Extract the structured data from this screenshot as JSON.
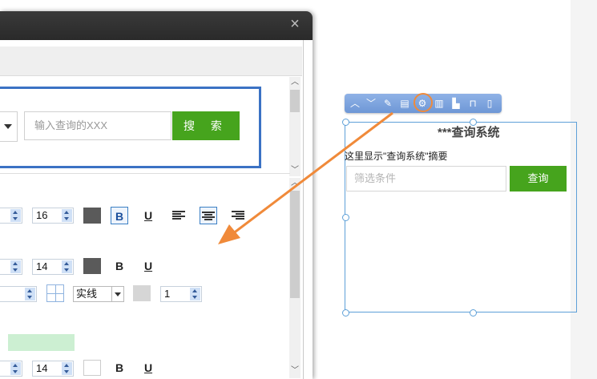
{
  "dialog": {
    "close_icon": "×",
    "preview": {
      "search_placeholder": "输入查询的XXX",
      "search_button": "搜 索"
    },
    "properties": {
      "row1": {
        "font_size": "16",
        "bold": "B",
        "underline": "U"
      },
      "row2": {
        "font_size": "14",
        "bold": "B",
        "underline": "U"
      },
      "row3": {
        "border_style": "实线",
        "border_width": "1"
      },
      "row5": {
        "font_size": "14",
        "bold": "B",
        "underline": "U"
      }
    }
  },
  "toolbar": {
    "icons": [
      "chevron-up-icon",
      "chevron-down-icon",
      "edit-icon",
      "layout-icon",
      "settings-icon",
      "columns-icon",
      "chart-icon",
      "unlock-icon",
      "trash-icon"
    ]
  },
  "canvas": {
    "title": "***查询系统",
    "summary": "这里显示\"查询系统\"摘要",
    "filter_placeholder": "筛选条件",
    "query_button": "查询"
  },
  "colors": {
    "accent_blue": "#3b72c4",
    "button_green": "#46a41d",
    "arrow_orange": "#f08a3a"
  }
}
